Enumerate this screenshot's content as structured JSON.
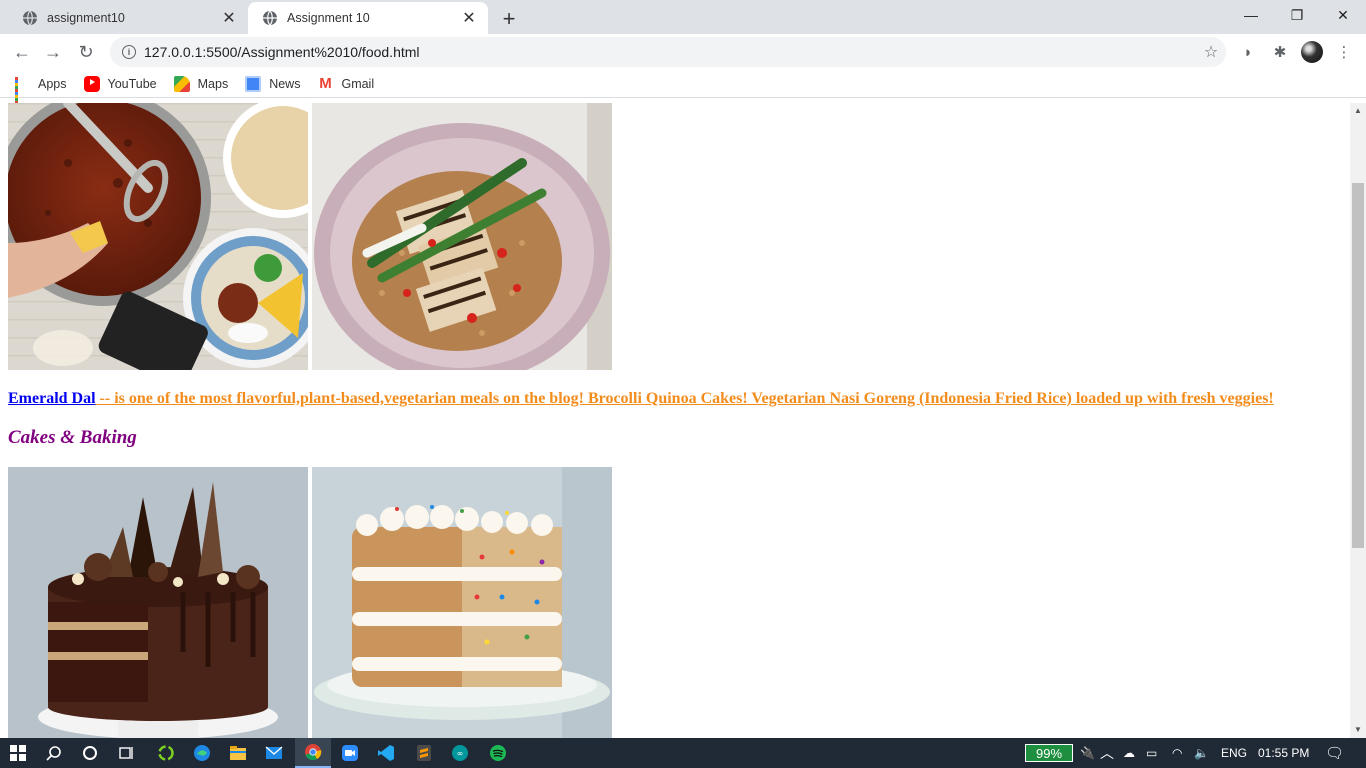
{
  "browser": {
    "tabs": [
      {
        "title": "assignment10",
        "active": false
      },
      {
        "title": "Assignment 10",
        "active": true
      }
    ],
    "address": "127.0.0.1:5500/Assignment%2010/food.html",
    "bookmarks": [
      {
        "label": "Apps",
        "icon": "apps-grid-icon"
      },
      {
        "label": "YouTube",
        "icon": "youtube-icon"
      },
      {
        "label": "Maps",
        "icon": "maps-icon"
      },
      {
        "label": "News",
        "icon": "news-icon"
      },
      {
        "label": "Gmail",
        "icon": "gmail-icon"
      }
    ]
  },
  "page": {
    "images_top": [
      {
        "name": "chili-bowl-image",
        "alt": "Chili pot with rice"
      },
      {
        "name": "tofu-rice-bowl-image",
        "alt": "Grilled tofu rice bowl"
      }
    ],
    "description": {
      "link_text": "Emerald Dal",
      "rest_text": " -- is one of the most flavorful,plant-based,vegetarian meals on the blog! Brocolli Quinoa Cakes! Vegetarian Nasi Goreng (Indonesia Fried Rice) loaded up with fresh veggies!"
    },
    "section_heading": "Cakes & Baking",
    "images_bottom": [
      {
        "name": "chocolate-cake-image",
        "alt": "Chocolate drip cake"
      },
      {
        "name": "funfetti-cake-image",
        "alt": "Sprinkle layer cake"
      }
    ],
    "colors": {
      "link": "#0000ee",
      "orange_text": "#f28c1c",
      "heading": "#800080"
    }
  },
  "taskbar": {
    "battery": "99%",
    "language": "ENG",
    "time": "01:55 PM"
  }
}
